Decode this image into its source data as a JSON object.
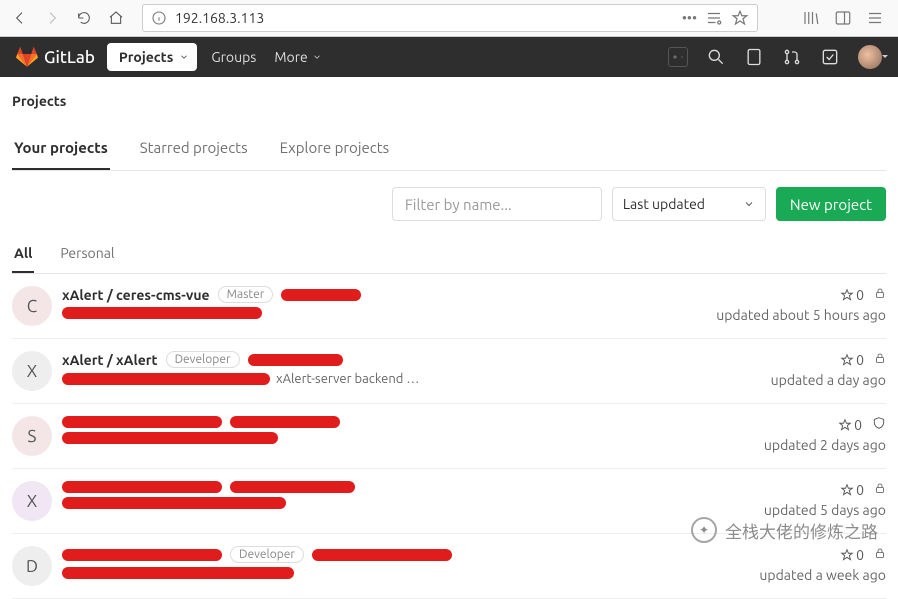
{
  "browser": {
    "url": "192.168.3.113"
  },
  "topbar": {
    "brand": "GitLab",
    "projects_label": "Projects",
    "groups_label": "Groups",
    "more_label": "More"
  },
  "page": {
    "title": "Projects"
  },
  "tabs": {
    "your": "Your projects",
    "starred": "Starred projects",
    "explore": "Explore projects"
  },
  "controls": {
    "filter_placeholder": "Filter by name...",
    "sort_selected": "Last updated",
    "new_project": "New project"
  },
  "subtabs": {
    "all": "All",
    "personal": "Personal"
  },
  "projects": [
    {
      "avatar_letter": "C",
      "avatar_bg": "#f4e6e6",
      "name": "xAlert / ceres-cms-vue",
      "badge": "Master",
      "desc": "",
      "stars": "0",
      "vis_icon": "lock",
      "updated": "updated about 5 hours ago"
    },
    {
      "avatar_letter": "X",
      "avatar_bg": "#eeeeee",
      "name": "xAlert / xAlert",
      "badge": "Developer",
      "desc": "xAlert-server backend …",
      "stars": "0",
      "vis_icon": "lock",
      "updated": "updated a day ago"
    },
    {
      "avatar_letter": "S",
      "avatar_bg": "#f4e6e6",
      "name": "",
      "badge": "",
      "desc": "",
      "stars": "0",
      "vis_icon": "shield",
      "updated": "updated 2 days ago"
    },
    {
      "avatar_letter": "X",
      "avatar_bg": "#f0e6f4",
      "name": "",
      "badge": "",
      "desc": "",
      "stars": "0",
      "vis_icon": "lock",
      "updated": "updated 5 days ago"
    },
    {
      "avatar_letter": "D",
      "avatar_bg": "#eeeeee",
      "name": "",
      "badge": "Developer",
      "desc": "",
      "stars": "0",
      "vis_icon": "lock",
      "updated": "updated a week ago"
    }
  ],
  "watermark": "全栈大佬的修炼之路"
}
